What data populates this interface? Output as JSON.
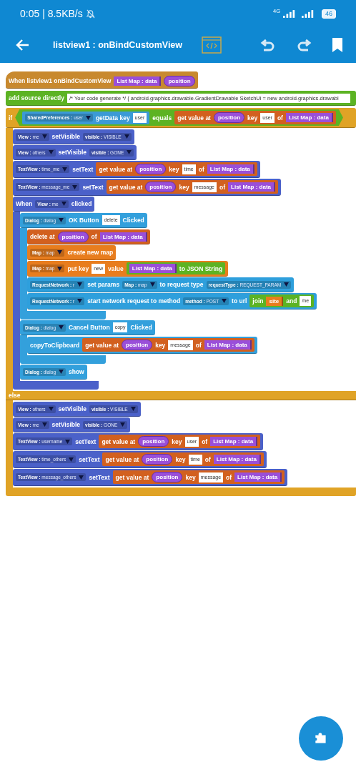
{
  "status_bar": {
    "time": "0:05 | 8.5KB/s",
    "network": "4G",
    "battery": "46"
  },
  "app_bar": {
    "title": "listview1 : onBindCustomView"
  },
  "event": {
    "kind": "event",
    "color": "#c8892e",
    "parts": [
      {
        "kind": "label",
        "text": "When listview1 onBindCustomView"
      },
      {
        "kind": "var",
        "text": "List Map : data",
        "color": "#9a4fd9"
      },
      {
        "kind": "param",
        "text": "position"
      }
    ],
    "body": [
      {
        "kind": "source",
        "color": "#5cb323",
        "parts": [
          {
            "kind": "label",
            "text": "add source directly"
          },
          {
            "kind": "input",
            "text": "/* Your code generate */ { android.graphics.drawable.GradientDrawable SketchUi = new android.graphics.drawabl"
          }
        ]
      },
      {
        "kind": "if",
        "color": "#e0a326",
        "label": "if",
        "else_label": "else",
        "condition": {
          "kind": "boolean",
          "color": "#5cb323",
          "parts": [
            {
              "kind": "reporter",
              "color": "#3b9ad6",
              "parts": [
                {
                  "kind": "dropdown",
                  "text": "**SharedPreferences :** user"
                },
                {
                  "kind": "label",
                  "text": "getData key"
                },
                {
                  "kind": "input",
                  "text": "user"
                }
              ]
            },
            {
              "kind": "label",
              "text": "equals"
            },
            {
              "kind": "reporter",
              "color": "#d2601f",
              "parts": [
                {
                  "kind": "label",
                  "text": "get value at"
                },
                {
                  "kind": "param",
                  "text": "position"
                },
                {
                  "kind": "label",
                  "text": "key"
                },
                {
                  "kind": "input",
                  "text": "user"
                },
                {
                  "kind": "label",
                  "text": "of"
                },
                {
                  "kind": "var",
                  "text": "List Map : data",
                  "color": "#9a4fd9"
                }
              ]
            }
          ]
        },
        "body": [
          {
            "kind": "statement",
            "color": "#4b61c9",
            "parts": [
              {
                "kind": "dropdown",
                "text": "**View :** me"
              },
              {
                "kind": "label",
                "text": "setVisible"
              },
              {
                "kind": "dropdown",
                "text": "**visible :** VISIBLE"
              }
            ]
          },
          {
            "kind": "statement",
            "color": "#4b61c9",
            "parts": [
              {
                "kind": "dropdown",
                "text": "**View :** others"
              },
              {
                "kind": "label",
                "text": "setVisible"
              },
              {
                "kind": "dropdown",
                "text": "**visible :** GONE"
              }
            ]
          },
          {
            "kind": "statement",
            "color": "#4b61c9",
            "parts": [
              {
                "kind": "dropdown",
                "text": "**TextView :** time_me"
              },
              {
                "kind": "label",
                "text": "setText"
              },
              {
                "kind": "reporter",
                "color": "#d2601f",
                "parts": [
                  {
                    "kind": "label",
                    "text": "get value at"
                  },
                  {
                    "kind": "param",
                    "text": "position"
                  },
                  {
                    "kind": "label",
                    "text": "key"
                  },
                  {
                    "kind": "input",
                    "text": "time"
                  },
                  {
                    "kind": "label",
                    "text": "of"
                  },
                  {
                    "kind": "var",
                    "text": "List Map : data",
                    "color": "#9a4fd9"
                  }
                ]
              }
            ]
          },
          {
            "kind": "statement",
            "color": "#4b61c9",
            "parts": [
              {
                "kind": "dropdown",
                "text": "**TextView :** message_me"
              },
              {
                "kind": "label",
                "text": "setText"
              },
              {
                "kind": "reporter",
                "color": "#d2601f",
                "parts": [
                  {
                    "kind": "label",
                    "text": "get value at"
                  },
                  {
                    "kind": "param",
                    "text": "position"
                  },
                  {
                    "kind": "label",
                    "text": "key"
                  },
                  {
                    "kind": "input",
                    "text": "message"
                  },
                  {
                    "kind": "label",
                    "text": "of"
                  },
                  {
                    "kind": "var",
                    "text": "List Map : data",
                    "color": "#9a4fd9"
                  }
                ]
              }
            ]
          },
          {
            "kind": "c-block",
            "color": "#4b61c9",
            "parts": [
              {
                "kind": "label",
                "text": "When"
              },
              {
                "kind": "dropdown",
                "text": "**View :** me"
              },
              {
                "kind": "label",
                "text": "clicked"
              }
            ],
            "body": [
              {
                "kind": "c-block",
                "color": "#33a0dc",
                "parts": [
                  {
                    "kind": "dropdown",
                    "text": "**Dialog :** dialog"
                  },
                  {
                    "kind": "label",
                    "text": "OK Button"
                  },
                  {
                    "kind": "input",
                    "text": "delete"
                  },
                  {
                    "kind": "label",
                    "text": "Clicked"
                  }
                ],
                "body": [
                  {
                    "kind": "statement",
                    "color": "#d2601f",
                    "parts": [
                      {
                        "kind": "label",
                        "text": "delete at"
                      },
                      {
                        "kind": "param",
                        "text": "position"
                      },
                      {
                        "kind": "label",
                        "text": "of"
                      },
                      {
                        "kind": "var",
                        "text": "List Map : data",
                        "color": "#9a4fd9"
                      }
                    ]
                  },
                  {
                    "kind": "statement",
                    "color": "#e87d1e",
                    "parts": [
                      {
                        "kind": "dropdown",
                        "text": "**Map :** map"
                      },
                      {
                        "kind": "label",
                        "text": "create new map"
                      }
                    ]
                  },
                  {
                    "kind": "statement",
                    "color": "#e87d1e",
                    "parts": [
                      {
                        "kind": "dropdown",
                        "text": "**Map :** map"
                      },
                      {
                        "kind": "label",
                        "text": "put key"
                      },
                      {
                        "kind": "input",
                        "text": "new"
                      },
                      {
                        "kind": "label",
                        "text": "value"
                      },
                      {
                        "kind": "reporter",
                        "color": "#5cb323",
                        "parts": [
                          {
                            "kind": "var",
                            "text": "List Map : data",
                            "color": "#9a4fd9"
                          },
                          {
                            "kind": "label",
                            "text": "to JSON String"
                          }
                        ]
                      }
                    ]
                  },
                  {
                    "kind": "statement",
                    "color": "#2e9fdc",
                    "parts": [
                      {
                        "kind": "dropdown",
                        "text": "**RequestNetwork :** r"
                      },
                      {
                        "kind": "label",
                        "text": "set params"
                      },
                      {
                        "kind": "dropdown",
                        "text": "**Map :** map"
                      },
                      {
                        "kind": "label",
                        "text": "to request type"
                      },
                      {
                        "kind": "dropdown",
                        "text": "**requestType :** REQUEST_PARAM"
                      }
                    ]
                  },
                  {
                    "kind": "statement",
                    "color": "#2e9fdc",
                    "parts": [
                      {
                        "kind": "dropdown",
                        "text": "**RequestNetwork :** r"
                      },
                      {
                        "kind": "label",
                        "text": "start network request to method"
                      },
                      {
                        "kind": "dropdown",
                        "text": "**method :** POST"
                      },
                      {
                        "kind": "label",
                        "text": "to url"
                      },
                      {
                        "kind": "reporter",
                        "color": "#5cb323",
                        "parts": [
                          {
                            "kind": "label",
                            "text": "join"
                          },
                          {
                            "kind": "var",
                            "text": "site",
                            "color": "#e87d1e"
                          },
                          {
                            "kind": "label",
                            "text": "and"
                          },
                          {
                            "kind": "input",
                            "text": "/ne"
                          }
                        ]
                      }
                    ]
                  }
                ]
              },
              {
                "kind": "c-block",
                "color": "#33a0dc",
                "parts": [
                  {
                    "kind": "dropdown",
                    "text": "**Dialog :** dialog"
                  },
                  {
                    "kind": "label",
                    "text": "Cancel Button"
                  },
                  {
                    "kind": "input",
                    "text": "copy"
                  },
                  {
                    "kind": "label",
                    "text": "Clicked"
                  }
                ],
                "body": [
                  {
                    "kind": "statement",
                    "color": "#33a0dc",
                    "parts": [
                      {
                        "kind": "label",
                        "text": "copyToClipboard"
                      },
                      {
                        "kind": "reporter",
                        "color": "#d2601f",
                        "parts": [
                          {
                            "kind": "label",
                            "text": "get value at"
                          },
                          {
                            "kind": "param",
                            "text": "position"
                          },
                          {
                            "kind": "label",
                            "text": "key"
                          },
                          {
                            "kind": "input",
                            "text": "message"
                          },
                          {
                            "kind": "label",
                            "text": "of"
                          },
                          {
                            "kind": "var",
                            "text": "List Map : data",
                            "color": "#9a4fd9"
                          }
                        ]
                      }
                    ]
                  }
                ]
              },
              {
                "kind": "statement",
                "color": "#33a0dc",
                "parts": [
                  {
                    "kind": "dropdown",
                    "text": "**Dialog :** dialog"
                  },
                  {
                    "kind": "label",
                    "text": "show"
                  }
                ]
              }
            ]
          }
        ],
        "else_body": [
          {
            "kind": "statement",
            "color": "#4b61c9",
            "parts": [
              {
                "kind": "dropdown",
                "text": "**View :** others"
              },
              {
                "kind": "label",
                "text": "setVisible"
              },
              {
                "kind": "dropdown",
                "text": "**visible :** VISIBLE"
              }
            ]
          },
          {
            "kind": "statement",
            "color": "#4b61c9",
            "parts": [
              {
                "kind": "dropdown",
                "text": "**View :** me"
              },
              {
                "kind": "label",
                "text": "setVisible"
              },
              {
                "kind": "dropdown",
                "text": "**visible :** GONE"
              }
            ]
          },
          {
            "kind": "statement",
            "color": "#4b61c9",
            "parts": [
              {
                "kind": "dropdown",
                "text": "**TextView :** username"
              },
              {
                "kind": "label",
                "text": "setText"
              },
              {
                "kind": "reporter",
                "color": "#d2601f",
                "parts": [
                  {
                    "kind": "label",
                    "text": "get value at"
                  },
                  {
                    "kind": "param",
                    "text": "position"
                  },
                  {
                    "kind": "label",
                    "text": "key"
                  },
                  {
                    "kind": "input",
                    "text": "user"
                  },
                  {
                    "kind": "label",
                    "text": "of"
                  },
                  {
                    "kind": "var",
                    "text": "List Map : data",
                    "color": "#9a4fd9"
                  }
                ]
              }
            ]
          },
          {
            "kind": "statement",
            "color": "#4b61c9",
            "parts": [
              {
                "kind": "dropdown",
                "text": "**TextView :** time_others"
              },
              {
                "kind": "label",
                "text": "setText"
              },
              {
                "kind": "reporter",
                "color": "#d2601f",
                "parts": [
                  {
                    "kind": "label",
                    "text": "get value at"
                  },
                  {
                    "kind": "param",
                    "text": "position"
                  },
                  {
                    "kind": "label",
                    "text": "key"
                  },
                  {
                    "kind": "input",
                    "text": "time"
                  },
                  {
                    "kind": "label",
                    "text": "of"
                  },
                  {
                    "kind": "var",
                    "text": "List Map : data",
                    "color": "#9a4fd9"
                  }
                ]
              }
            ]
          },
          {
            "kind": "statement",
            "color": "#4b61c9",
            "parts": [
              {
                "kind": "dropdown",
                "text": "**TextView :** message_others"
              },
              {
                "kind": "label",
                "text": "setText"
              },
              {
                "kind": "reporter",
                "color": "#d2601f",
                "parts": [
                  {
                    "kind": "label",
                    "text": "get value at"
                  },
                  {
                    "kind": "param",
                    "text": "position"
                  },
                  {
                    "kind": "label",
                    "text": "key"
                  },
                  {
                    "kind": "input",
                    "text": "message"
                  },
                  {
                    "kind": "label",
                    "text": "of"
                  },
                  {
                    "kind": "var",
                    "text": "List Map : data",
                    "color": "#9a4fd9"
                  }
                ]
              }
            ]
          }
        ]
      }
    ]
  }
}
